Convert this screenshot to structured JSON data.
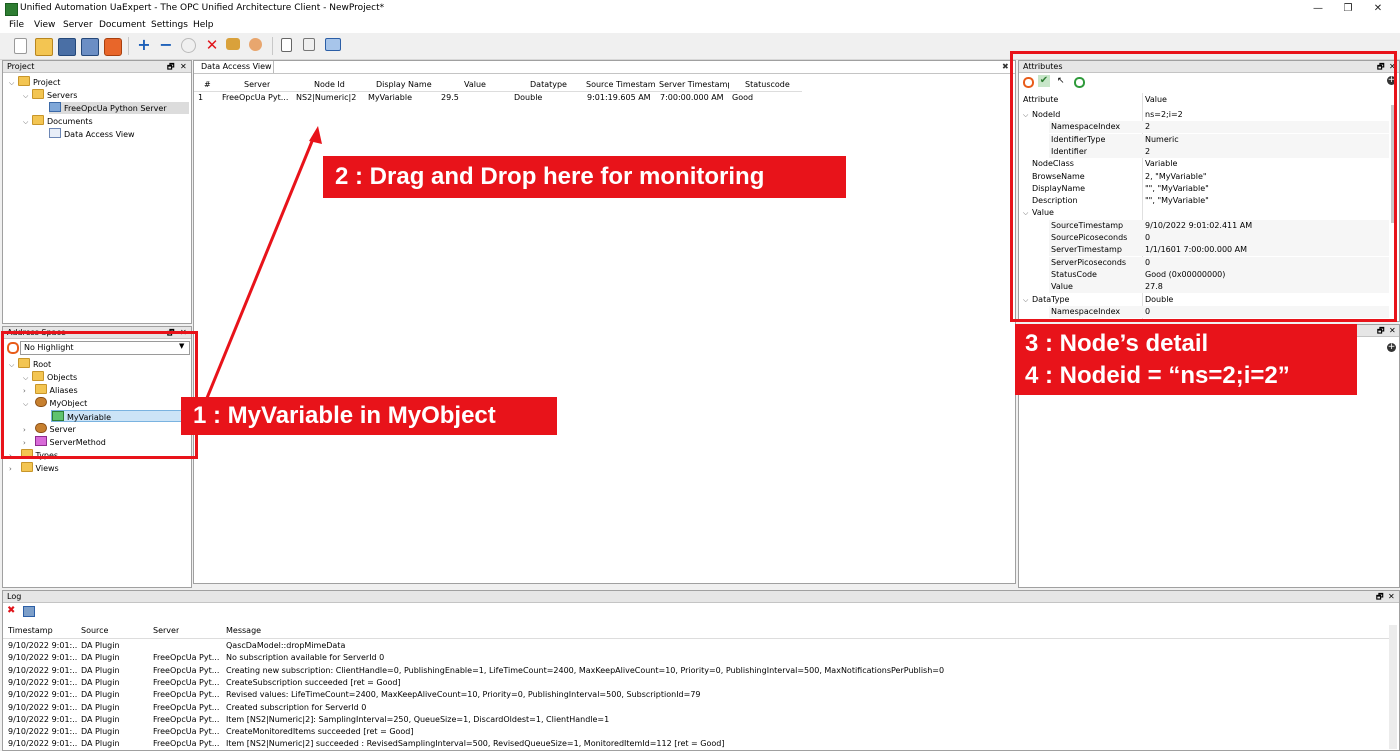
{
  "window": {
    "title": "Unified Automation UaExpert - The OPC Unified Architecture Client - NewProject*",
    "min": "—",
    "max": "❐",
    "close": "✕"
  },
  "menu": [
    "File",
    "View",
    "Server",
    "Document",
    "Settings",
    "Help"
  ],
  "toolbar_icons": [
    "new-icon",
    "open-icon",
    "save-icon",
    "save-as-icon",
    "power-icon",
    "add-server-icon",
    "remove-server-icon",
    "connect-icon",
    "disconnect-icon",
    "settings-icon",
    "user-icon",
    "report-icon",
    "delete-icon",
    "window-icon"
  ],
  "project": {
    "header": "Project",
    "items": [
      {
        "label": "Project",
        "icon": "folder"
      },
      {
        "label": "Servers",
        "icon": "folder"
      },
      {
        "label": "FreeOpcUa Python Server",
        "icon": "server"
      },
      {
        "label": "Documents",
        "icon": "folder"
      },
      {
        "label": "Data Access View",
        "icon": "doc"
      }
    ]
  },
  "address_space": {
    "header": "Address Space",
    "highlight": "No Highlight",
    "items": [
      {
        "label": "Root",
        "icon": "folder"
      },
      {
        "label": "Objects",
        "icon": "folder"
      },
      {
        "label": "Aliases",
        "icon": "folder"
      },
      {
        "label": "MyObject",
        "icon": "object"
      },
      {
        "label": "MyVariable",
        "icon": "variable"
      },
      {
        "label": "Server",
        "icon": "object"
      },
      {
        "label": "ServerMethod",
        "icon": "method"
      },
      {
        "label": "Types",
        "icon": "folder"
      },
      {
        "label": "Views",
        "icon": "folder"
      }
    ]
  },
  "da_view": {
    "tab": "Data Access View",
    "columns": [
      "#",
      "Server",
      "Node Id",
      "Display Name",
      "Value",
      "Datatype",
      "Source Timestamp",
      "Server Timestamp",
      "Statuscode"
    ],
    "rows": [
      [
        "1",
        "FreeOpcUa Pyt...",
        "NS2|Numeric|2",
        "MyVariable",
        "29.5",
        "Double",
        "9:01:19.605 AM",
        "7:00:00.000 AM",
        "Good"
      ]
    ]
  },
  "attributes": {
    "header": "Attributes",
    "col_attr": "Attribute",
    "col_value": "Value",
    "rows": [
      {
        "name": "NodeId",
        "value": "ns=2;i=2",
        "level": 0,
        "expanded": true
      },
      {
        "name": "NamespaceIndex",
        "value": "2",
        "level": 1
      },
      {
        "name": "IdentifierType",
        "value": "Numeric",
        "level": 1
      },
      {
        "name": "Identifier",
        "value": "2",
        "level": 1
      },
      {
        "name": "NodeClass",
        "value": "Variable",
        "level": 0
      },
      {
        "name": "BrowseName",
        "value": "2, \"MyVariable\"",
        "level": 0
      },
      {
        "name": "DisplayName",
        "value": "\"\", \"MyVariable\"",
        "level": 0
      },
      {
        "name": "Description",
        "value": "\"\", \"MyVariable\"",
        "level": 0
      },
      {
        "name": "Value",
        "value": "",
        "level": 0,
        "expanded": true
      },
      {
        "name": "SourceTimestamp",
        "value": "9/10/2022 9:01:02.411 AM",
        "level": 1
      },
      {
        "name": "SourcePicoseconds",
        "value": "0",
        "level": 1
      },
      {
        "name": "ServerTimestamp",
        "value": "1/1/1601 7:00:00.000 AM",
        "level": 1
      },
      {
        "name": "ServerPicoseconds",
        "value": "0",
        "level": 1
      },
      {
        "name": "StatusCode",
        "value": "Good (0x00000000)",
        "level": 1
      },
      {
        "name": "Value",
        "value": "27.8",
        "level": 1
      },
      {
        "name": "DataType",
        "value": "Double",
        "level": 0,
        "expanded": true
      },
      {
        "name": "NamespaceIndex",
        "value": "0",
        "level": 1
      }
    ]
  },
  "log": {
    "header": "Log",
    "columns": [
      "Timestamp",
      "Source",
      "Server",
      "Message"
    ],
    "rows": [
      [
        "9/10/2022 9:01:...",
        "DA Plugin",
        "",
        "QascDaModel::dropMimeData"
      ],
      [
        "9/10/2022 9:01:...",
        "DA Plugin",
        "FreeOpcUa Pyt...",
        "No subscription available for ServerId 0"
      ],
      [
        "9/10/2022 9:01:...",
        "DA Plugin",
        "FreeOpcUa Pyt...",
        "Creating new subscription: ClientHandle=0, PublishingEnable=1, LifeTimeCount=2400, MaxKeepAliveCount=10, Priority=0, PublishingInterval=500, MaxNotificationsPerPublish=0"
      ],
      [
        "9/10/2022 9:01:...",
        "DA Plugin",
        "FreeOpcUa Pyt...",
        "CreateSubscription succeeded [ret = Good]"
      ],
      [
        "9/10/2022 9:01:...",
        "DA Plugin",
        "FreeOpcUa Pyt...",
        "Revised values: LifeTimeCount=2400, MaxKeepAliveCount=10, Priority=0, PublishingInterval=500, SubscriptionId=79"
      ],
      [
        "9/10/2022 9:01:...",
        "DA Plugin",
        "FreeOpcUa Pyt...",
        "Created subscription for ServerId 0"
      ],
      [
        "9/10/2022 9:01:...",
        "DA Plugin",
        "FreeOpcUa Pyt...",
        "Item [NS2|Numeric|2]: SamplingInterval=250, QueueSize=1, DiscardOldest=1, ClientHandle=1"
      ],
      [
        "9/10/2022 9:01:...",
        "DA Plugin",
        "FreeOpcUa Pyt...",
        "CreateMonitoredItems succeeded [ret = Good]"
      ],
      [
        "9/10/2022 9:01:...",
        "DA Plugin",
        "FreeOpcUa Pyt...",
        "Item [NS2|Numeric|2] succeeded : RevisedSamplingInterval=500, RevisedQueueSize=1, MonitoredItemId=112 [ret = Good]"
      ]
    ]
  },
  "annotations": {
    "c1": "1 : MyVariable in MyObject",
    "c2": "2 : Drag and Drop here for monitoring",
    "c3_line1": "3 : Node’s detail",
    "c3_line2": "4 : Nodeid = “ns=2;i=2”"
  },
  "colors": {
    "annotation": "#e8131a",
    "selection": "#cce4f7"
  }
}
